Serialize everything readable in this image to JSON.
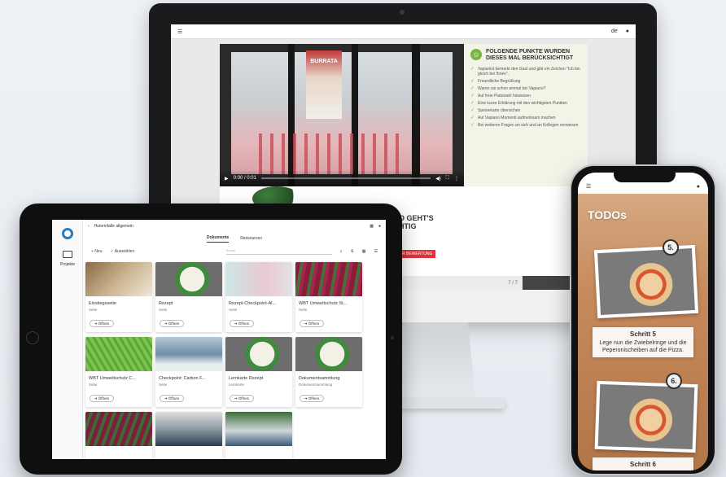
{
  "desktop": {
    "lang": "de",
    "video": {
      "poster_text": "BURRATA",
      "time": "0:00 / 0:01"
    },
    "checklist": {
      "title": "FOLGENDE PUNKTE WURDEN DIESES MAL BERÜCKSICHTIGT",
      "items": [
        "Vapianist bemerkt den Gast und gibt ein Zeichen \"Ich bin gleich bei Ihnen\".",
        "Freundliche Begrüßung",
        "Waren sie schon einmal bei Vapiano?",
        "Auf freie Platzwahl hinweisen",
        "Eine kurze Erklärung mit den wichtigsten Punkten",
        "Speisekarte übersichen",
        "Auf Vapiano Momenti aufmerksam machen",
        "Bei weiteren Fragen an sich und an Kollegen verweisen"
      ]
    },
    "go_title": "O GEHT'S\nHTIG",
    "go_button": "R BEWERTUNG",
    "pager_left": "‹",
    "pager_right": "7 / 7"
  },
  "tablet": {
    "breadcrumb": "Hutorinfalle allgemein",
    "nav_label": "Projekte",
    "tabs": [
      "Dokumente",
      "Ressourcen"
    ],
    "toolbar": {
      "new": "+ Neu",
      "select": "✓ Auswählen",
      "search_placeholder": "Suche"
    },
    "open_label": "Öffnen",
    "cards": [
      {
        "name": "Einstiegsseite",
        "type": "Seite"
      },
      {
        "name": "Rezept",
        "type": "Seite"
      },
      {
        "name": "Rezept-Checkpoint-Al...",
        "type": "Seite"
      },
      {
        "name": "WBT Umweltschutz St...",
        "type": "Seite"
      },
      {
        "name": "WBT Umweltschutz C...",
        "type": "Seite"
      },
      {
        "name": "Checkpoint: Carbon F...",
        "type": "Seite"
      },
      {
        "name": "Lernkarte Rezept",
        "type": "Lernkarte"
      },
      {
        "name": "Dokumentsammlung",
        "type": "Dokumentsammlung"
      },
      {
        "name": "",
        "type": ""
      },
      {
        "name": "",
        "type": ""
      },
      {
        "name": "",
        "type": ""
      }
    ]
  },
  "phone": {
    "title": "TODOs",
    "steps": [
      {
        "number": "5.",
        "label": "Schritt 5",
        "text": "Lege nun die Zwiebelringe und die Peperonischeiben auf die Pizza."
      },
      {
        "number": "6.",
        "label": "Schritt 6",
        "text": ""
      }
    ]
  },
  "colors": {
    "accent_green": "#7cb342",
    "cta_red": "#e0323c",
    "brand_blue": "#2a7bbd"
  }
}
